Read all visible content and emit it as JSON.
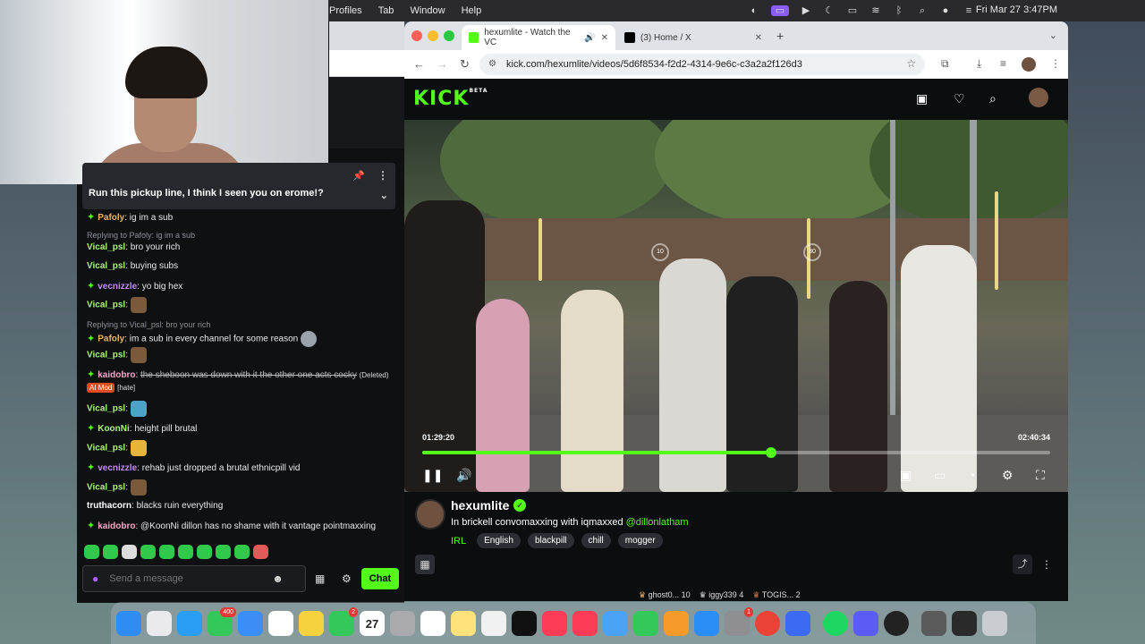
{
  "menubar": {
    "items": [
      "Profiles",
      "Tab",
      "Window",
      "Help"
    ],
    "clock": "Fri Mar 27  3:47PM"
  },
  "pinned": {
    "text": "Run this pickup line, I think I seen you on erome!?"
  },
  "chat": {
    "messages": [
      {
        "user": "Pafoly",
        "user_color": "#e9b26a",
        "badge": true,
        "text": "ig im a sub"
      },
      {
        "reply_to": "Replying to Pafoly: ig im a sub",
        "user": "Vical_psl",
        "user_color": "#a6f27a",
        "text": "bro your rich"
      },
      {
        "user": "Vical_psl",
        "user_color": "#a6f27a",
        "text": "buying subs"
      },
      {
        "user": "vecnizzle",
        "user_color": "#c488ff",
        "badge": true,
        "text": "yo big hex"
      },
      {
        "user": "Vical_psl",
        "user_color": "#a6f27a",
        "text": "",
        "emote": true
      },
      {
        "reply_to": "Replying to Vical_psl: bro your rich",
        "user": "Pafoly",
        "user_color": "#e9b26a",
        "badge": true,
        "text": "im a sub in every channel for some reason",
        "emote": true
      },
      {
        "user": "Vical_psl",
        "user_color": "#a6f27a",
        "text": "",
        "emote": true
      },
      {
        "user": "kaidobro",
        "user_color": "#f2a6c8",
        "badge": true,
        "deleted_text": "the sheboon was down with it the other one acts cocky",
        "deleted_label": "(Deleted)",
        "ai_label": "AI Mod",
        "hate_label": "[hate]"
      },
      {
        "user": "Vical_psl",
        "user_color": "#a6f27a",
        "text": "",
        "emote": true
      },
      {
        "user": "KoonNi",
        "user_color": "#a6f27a",
        "badge": true,
        "text": "height pill brutal"
      },
      {
        "user": "Vical_psl",
        "user_color": "#a6f27a",
        "text": "",
        "emote": true
      },
      {
        "user": "vecnizzle",
        "user_color": "#c488ff",
        "badge": true,
        "text": "rehab just dropped a brutal ethnicpill vid"
      },
      {
        "user": "Vical_psl",
        "user_color": "#a6f27a",
        "text": "",
        "emote": true
      },
      {
        "user": "truthacorn",
        "user_color": "#ffffff",
        "text": "blacks ruin everything"
      },
      {
        "user": "kaidobro",
        "user_color": "#f2a6c8",
        "badge": true,
        "text": "@KoonNi dillon has no shame with it vantage pointmaxxing"
      }
    ],
    "input_placeholder": "Send a message",
    "chat_button": "Chat"
  },
  "browser": {
    "tabs": [
      {
        "label": "hexumlite - Watch the VC",
        "active": true
      },
      {
        "label": "(3) Home / X",
        "active": false
      }
    ],
    "url": "kick.com/hexumlite/videos/5d6f8534-f2d2-4314-9e6c-c3a2a2f126d3"
  },
  "kick": {
    "logo": "KICK",
    "logo_beta": "BETA"
  },
  "video": {
    "time_current": "01:29:20",
    "time_total": "02:40:34",
    "progress_fraction": 0.556,
    "seek_back": "10",
    "seek_fwd": "30"
  },
  "stream": {
    "name": "hexumlite",
    "title_prefix": "In brickell convomaxxing with iqmaxxed ",
    "title_mention": "@dillonlatham",
    "category": "IRL",
    "tags": [
      "English",
      "blackpill",
      "chill",
      "mogger"
    ]
  },
  "leaderboard": [
    {
      "name": "ghost0...",
      "value": "10"
    },
    {
      "name": "iggy339",
      "value": "4"
    },
    {
      "name": "TOGIS...",
      "value": "2"
    }
  ],
  "dock": {
    "calendar_day": "27",
    "messages_badge": "400",
    "facetime_badge": "2",
    "settings_badge": "1"
  },
  "colors": {
    "kick_green": "#53fc18",
    "background": "#0b0e0f"
  }
}
